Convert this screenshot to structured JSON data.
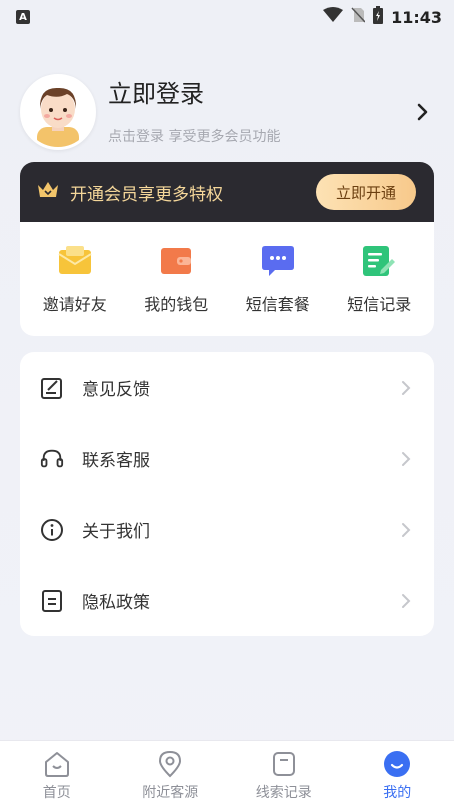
{
  "status_bar": {
    "app_badge": "A",
    "time": "11:43"
  },
  "profile": {
    "title": "立即登录",
    "subtitle": "点击登录 享受更多会员功能"
  },
  "vip": {
    "banner_text": "开通会员享更多特权",
    "button_label": "立即开通"
  },
  "features": [
    {
      "label": "邀请好友",
      "icon": "envelope-icon",
      "color": "#f7c43a"
    },
    {
      "label": "我的钱包",
      "icon": "wallet-icon",
      "color": "#f27a4a"
    },
    {
      "label": "短信套餐",
      "icon": "message-bubble-icon",
      "color": "#5a6cf0"
    },
    {
      "label": "短信记录",
      "icon": "note-edit-icon",
      "color": "#2fc47a"
    }
  ],
  "menu": [
    {
      "label": "意见反馈",
      "icon": "feedback-icon"
    },
    {
      "label": "联系客服",
      "icon": "headset-icon"
    },
    {
      "label": "关于我们",
      "icon": "info-icon"
    },
    {
      "label": "隐私政策",
      "icon": "document-icon"
    }
  ],
  "tabs": [
    {
      "label": "首页",
      "icon": "home-icon",
      "active": false
    },
    {
      "label": "附近客源",
      "icon": "location-pin-icon",
      "active": false
    },
    {
      "label": "线索记录",
      "icon": "record-icon",
      "active": false
    },
    {
      "label": "我的",
      "icon": "profile-icon",
      "active": true
    }
  ],
  "colors": {
    "accent": "#3a6ff2",
    "vip_banner_bg": "#2b2a30",
    "vip_text": "#f5d79a",
    "vip_button": "#f7c98b"
  }
}
